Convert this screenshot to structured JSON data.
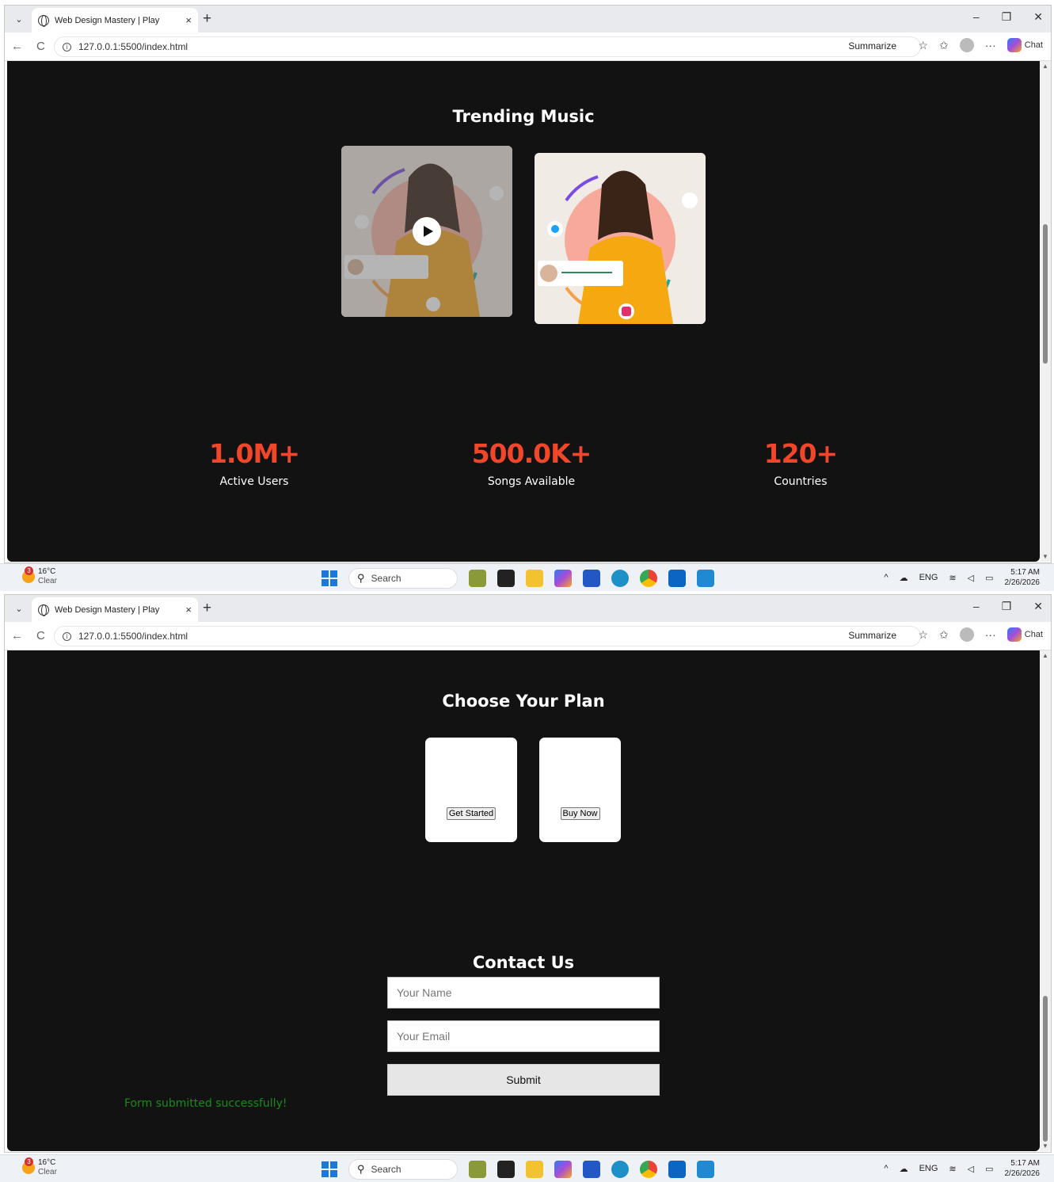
{
  "browser": {
    "tab_title": "Web Design Mastery | Play",
    "url": "127.0.0.1:5500/index.html",
    "summarize_label": "Summarize",
    "chat_label": "Chat",
    "new_tab": "+",
    "close_tab": "×",
    "minimize": "–",
    "restore": "❐",
    "close_window": "✕",
    "back": "←",
    "reload": "C",
    "more": "···",
    "star": "☆",
    "favorites": "✩"
  },
  "trending": {
    "title": "Trending Music",
    "play_icon": "play-icon"
  },
  "stats": [
    {
      "value": "1.0M+",
      "label": "Active Users"
    },
    {
      "value": "500.0K+",
      "label": "Songs Available"
    },
    {
      "value": "120+",
      "label": "Countries"
    }
  ],
  "plans": {
    "title": "Choose Your Plan",
    "buttons": [
      "Get Started",
      "Buy Now"
    ]
  },
  "contact": {
    "title": "Contact Us",
    "name_placeholder": "Your Name",
    "email_placeholder": "Your Email",
    "submit_label": "Submit",
    "success_message": "Form submitted successfully!"
  },
  "taskbar": {
    "temperature": "16°C",
    "condition": "Clear",
    "weather_badge": "3",
    "search_label": "Search",
    "language": "ENG",
    "time": "5:17 AM",
    "date": "2/26/2026"
  },
  "colors": {
    "page_bg": "#121212",
    "accent": "#f2462a",
    "success": "#1a8a1a"
  }
}
